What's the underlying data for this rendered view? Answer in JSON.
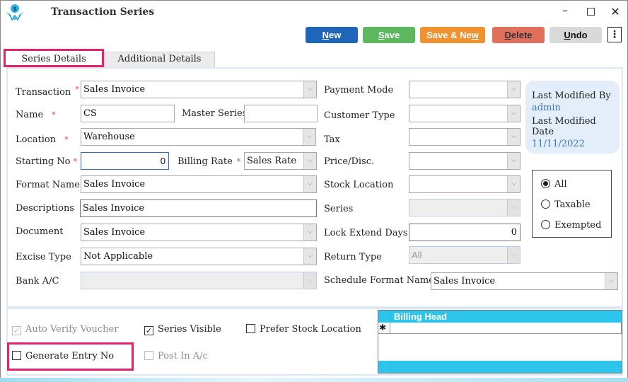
{
  "window": {
    "title": "Transaction Series",
    "controls": {
      "minimize": "–",
      "maximize": "",
      "close": "✕"
    }
  },
  "toolbar": {
    "new": {
      "pre": "",
      "key": "N",
      "post": "ew"
    },
    "save": {
      "pre": "",
      "key": "S",
      "post": "ave"
    },
    "save_new": {
      "pre": "Save & Ne",
      "key": "w",
      "post": ""
    },
    "delete": {
      "pre": "",
      "key": "D",
      "post": "elete"
    },
    "undo": {
      "pre": "",
      "key": "U",
      "post": "ndo"
    },
    "more": "⋮",
    "colors": {
      "new": "#1f66b8",
      "save": "#5cb85c",
      "save_new": "#f0922e",
      "delete": "#e0705c",
      "undo": "#d9d9d9"
    }
  },
  "tabs": [
    {
      "label": "Series Details",
      "active": true
    },
    {
      "label": "Additional Details",
      "active": false
    }
  ],
  "form": {
    "required_mark": "*",
    "transaction": {
      "label": "Transaction",
      "value": "Sales Invoice"
    },
    "name": {
      "label": "Name",
      "value": "CS"
    },
    "master_series": {
      "label": "Master Series",
      "value": ""
    },
    "location": {
      "label": "Location",
      "value": "Warehouse"
    },
    "starting_no": {
      "label": "Starting No",
      "value": "0"
    },
    "billing_rate": {
      "label": "Billing Rate",
      "value": "Sales Rate"
    },
    "format_name": {
      "label": "Format Name",
      "value": "Sales Invoice"
    },
    "descriptions": {
      "label": "Descriptions",
      "value": "Sales Invoice"
    },
    "document": {
      "label": "Document",
      "value": "Sales Invoice"
    },
    "excise_type": {
      "label": "Excise Type",
      "value": "Not Applicable"
    },
    "bank_ac": {
      "label": "Bank A/C",
      "value": ""
    },
    "payment_mode": {
      "label": "Payment Mode",
      "value": ""
    },
    "customer_type": {
      "label": "Customer Type",
      "value": ""
    },
    "tax": {
      "label": "Tax",
      "value": ""
    },
    "price_disc": {
      "label": "Price/Disc.",
      "value": ""
    },
    "stock_location": {
      "label": "Stock Location",
      "value": ""
    },
    "series": {
      "label": "Series",
      "value": ""
    },
    "lock_extend_days": {
      "label": "Lock Extend Days",
      "value": "0"
    },
    "return_type": {
      "label": "Return Type",
      "value": "All"
    },
    "schedule_format_name": {
      "label": "Schedule Format Name",
      "value": "Sales Invoice"
    },
    "dropdown_glyph": "⌵"
  },
  "info": {
    "modified_by_label": "Last Modified By",
    "modified_by": "admin",
    "modified_date_label": "Last Modified Date",
    "modified_date": "11/11/2022"
  },
  "tax_filter": {
    "options": [
      {
        "label": "All",
        "selected": true
      },
      {
        "label": "Taxable",
        "selected": false
      },
      {
        "label": "Exempted",
        "selected": false
      }
    ]
  },
  "options": {
    "auto_verify_voucher": {
      "label": "Auto Verify Voucher",
      "checked": true,
      "enabled": false
    },
    "series_visible": {
      "label": "Series Visible",
      "checked": true,
      "enabled": true
    },
    "prefer_stock_location": {
      "label": "Prefer Stock Location",
      "checked": false,
      "enabled": true
    },
    "generate_entry_no": {
      "label": "Generate Entry No",
      "checked": false,
      "enabled": true
    },
    "post_in_ac": {
      "label": "Post In A/c",
      "checked": false,
      "enabled": false
    },
    "check_glyph": "✓"
  },
  "billing_grid": {
    "header": "Billing Head",
    "new_row_marker": "✱",
    "rows": []
  }
}
